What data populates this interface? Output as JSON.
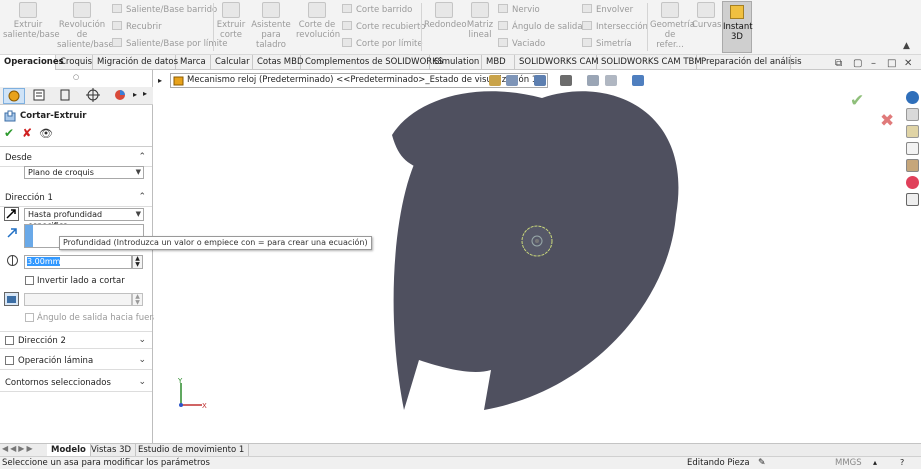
{
  "ribbon": {
    "extrude": "Extruir saliente/base",
    "revolve": "Revolución de saliente/base",
    "swept_boss": "Saliente/Base barrido",
    "recubrir": "Recubrir",
    "boundary_boss": "Saliente/Base por límite",
    "extruded_cut": "Extruir corte",
    "hole_wizard": "Asistente para taladro",
    "revolved_cut": "Corte de revolución",
    "swept_cut": "Corte barrido",
    "lofted_cut": "Corte recubierto",
    "boundary_cut": "Corte por límite",
    "fillet": "Redondeo",
    "linear_pattern": "Matriz lineal",
    "rib": "Nervio",
    "draft": "Ángulo de salida",
    "shell": "Vaciado",
    "wrap": "Envolver",
    "intersect": "Intersección",
    "mirror": "Simetría",
    "ref_geometry": "Geometría de refer...",
    "curves": "Curvas",
    "instant3d": "Instant 3D"
  },
  "tabs": [
    "Operaciones",
    "Croquis",
    "Migración de datos",
    "Marca",
    "Calcular",
    "Cotas MBD",
    "Complementos de SOLIDWORKS",
    "Simulation",
    "MBD",
    "SOLIDWORKS CAM",
    "SOLIDWORKS CAM TBM",
    "Preparación del análisis"
  ],
  "breadcrumb": "Mecanismo reloj (Predeterminado) <<Predeterminado>_Estado de visualización 1>",
  "panel": {
    "title": "Cortar-Extruir",
    "from_label": "Desde",
    "from_value": "Plano de croquis",
    "dir1_label": "Dirección 1",
    "end_condition": "Hasta profundidad especifica",
    "depth": "3.00mm",
    "flip_side": "Invertir lado a cortar",
    "draft_outward": "Ángulo de salida hacia fuera",
    "dir2_label": "Dirección 2",
    "thin_feature": "Operación lámina",
    "selected_contours": "Contornos seleccionados"
  },
  "tooltip": "Profundidad (Introduzca un valor o empiece con = para crear una ecuación)",
  "bottom_tabs": [
    "Modelo",
    "Vistas 3D",
    "Estudio de movimiento 1"
  ],
  "status": {
    "message": "Seleccione un asa para modificar los parámetros",
    "mode": "Editando Pieza",
    "units": "MMGS"
  },
  "axes": {
    "x": "X",
    "y": "Y"
  },
  "colors": {
    "part": "#4f505f",
    "accent": "#1f6fc4",
    "confirm": "#8fbf7a",
    "cancel": "#e07a7a"
  }
}
